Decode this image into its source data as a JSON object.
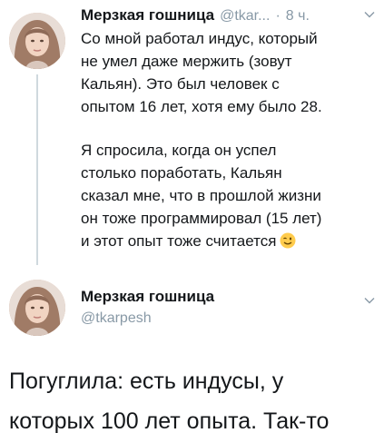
{
  "tweet1": {
    "display_name": "Мерзкая гошница",
    "handle_short": "@tkar...",
    "separator": "·",
    "time": "8 ч.",
    "paragraph1": [
      "Со мной работал индус, который",
      "не умел даже мержить (зовут",
      "Кальян).  Это был человек с",
      "опытом 16 лет, хотя ему было 28."
    ],
    "paragraph2": [
      "Я спросила, когда он успел",
      "столько поработать, Кальян",
      "сказал мне, что в прошлой жизни",
      "он тоже программировал (15 лет)",
      "и этот опыт тоже считается"
    ],
    "emoji": "winking-face-icon"
  },
  "tweet2": {
    "display_name": "Мерзкая гошница",
    "handle": "@tkarpesh",
    "text_lines": [
      "Погуглила: есть индусы, у",
      "которых 100 лет опыта. Так-то"
    ]
  },
  "colors": {
    "text": "#14171a",
    "secondary": "#8899a6",
    "thread_line": "#cfd9de",
    "background": "#ffffff"
  }
}
